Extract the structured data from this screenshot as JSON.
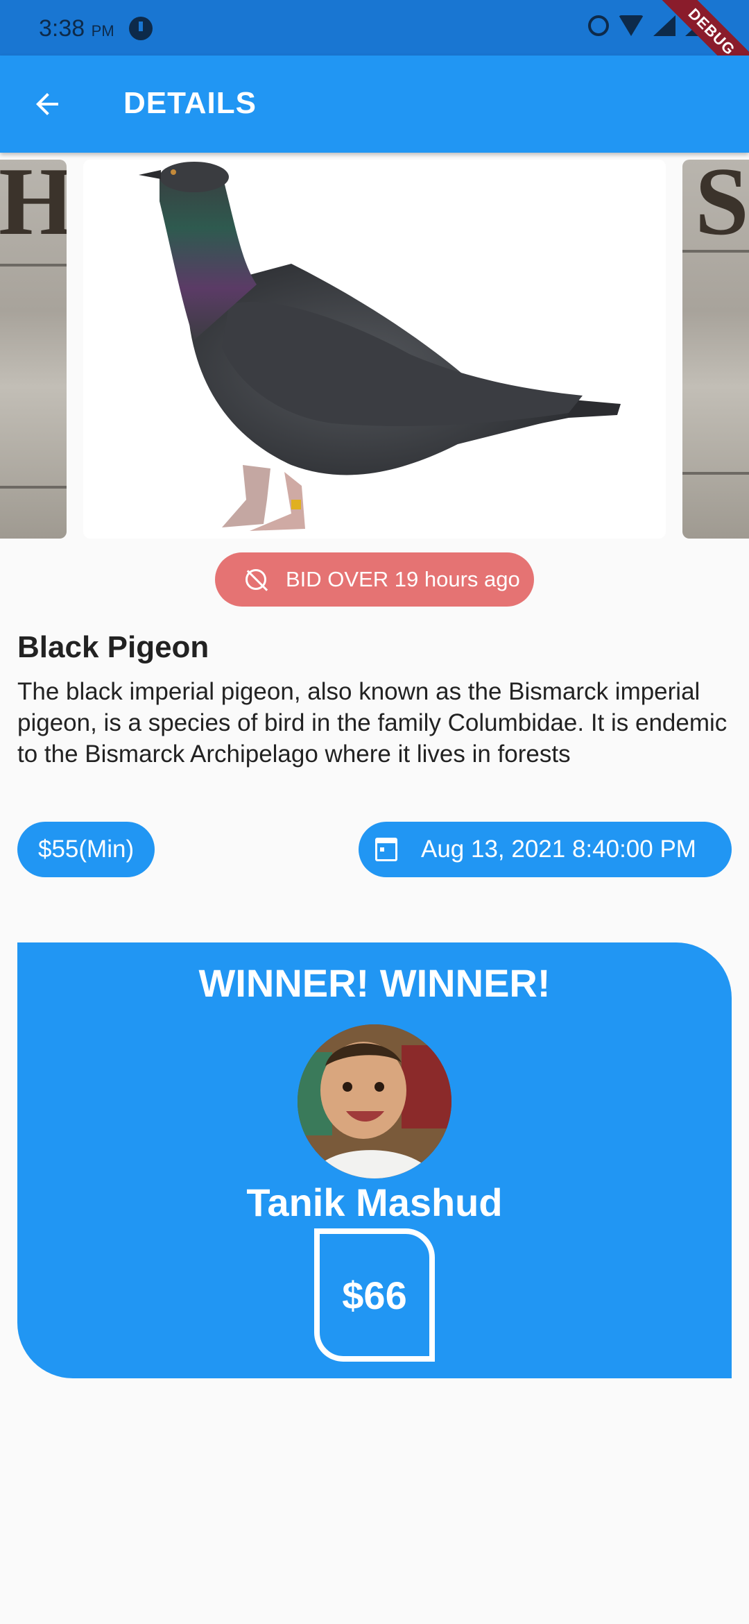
{
  "status_bar": {
    "time": "3:38",
    "ampm": "PM",
    "debug_label": "DEBUG"
  },
  "app_bar": {
    "title": "DETAILS"
  },
  "bid_status": "BID OVER 19 hours ago",
  "item": {
    "title": "Black Pigeon",
    "description": "The black imperial pigeon, also known as the Bismarck imperial pigeon, is a species of bird in the family Columbidae. It is endemic to the Bismarck Archipelago where it lives in forests"
  },
  "min_price": "$55(Min)",
  "end_date": "Aug 13, 2021 8:40:00 PM",
  "winner": {
    "heading": "WINNER! WINNER!",
    "name": "Tanik Mashud",
    "amount": "$66"
  },
  "colors": {
    "primary": "#2196f3",
    "status_bar": "#1976d2",
    "timer_pill": "#e57373",
    "background": "#fafafa"
  }
}
